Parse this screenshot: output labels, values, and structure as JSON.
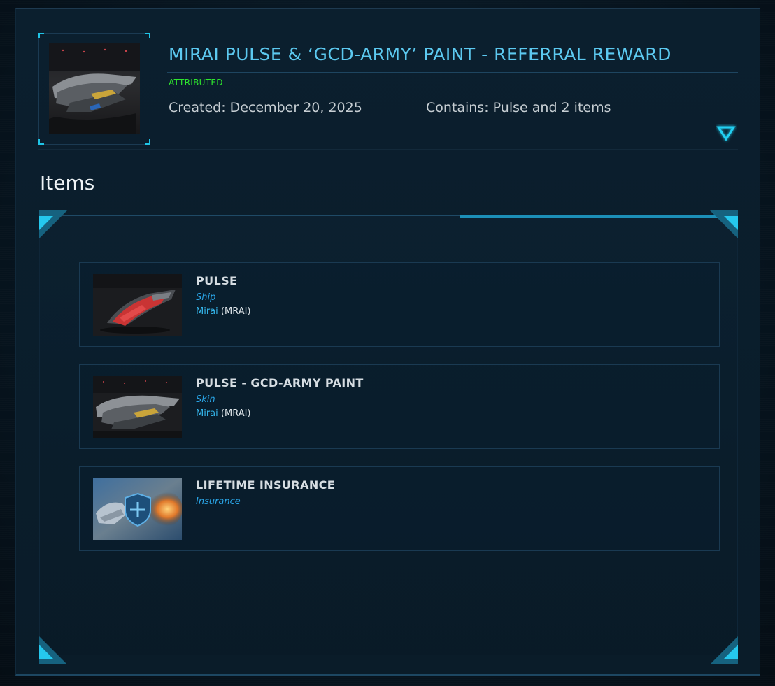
{
  "pledge": {
    "title": "MIRAI PULSE & ‘GCD-ARMY’ PAINT - REFERRAL REWARD",
    "status": "ATTRIBUTED",
    "created": "Created: December 20, 2025",
    "contains": "Contains: Pulse and 2 items",
    "thumbnail_icon": "ship-thumbnail"
  },
  "section": {
    "title": "Items"
  },
  "items": [
    {
      "name": "PULSE",
      "type": "Ship",
      "manufacturer": "Mirai",
      "manufacturer_code": "(MRAI)"
    },
    {
      "name": "PULSE - GCD-ARMY PAINT",
      "type": "Skin",
      "manufacturer": "Mirai",
      "manufacturer_code": "(MRAI)"
    },
    {
      "name": "LIFETIME INSURANCE",
      "type": "Insurance"
    }
  ],
  "colors": {
    "accent": "#1fc4e6",
    "title": "#5cc9f0",
    "status": "#2ee62e",
    "type_label": "#2aa6e8"
  }
}
